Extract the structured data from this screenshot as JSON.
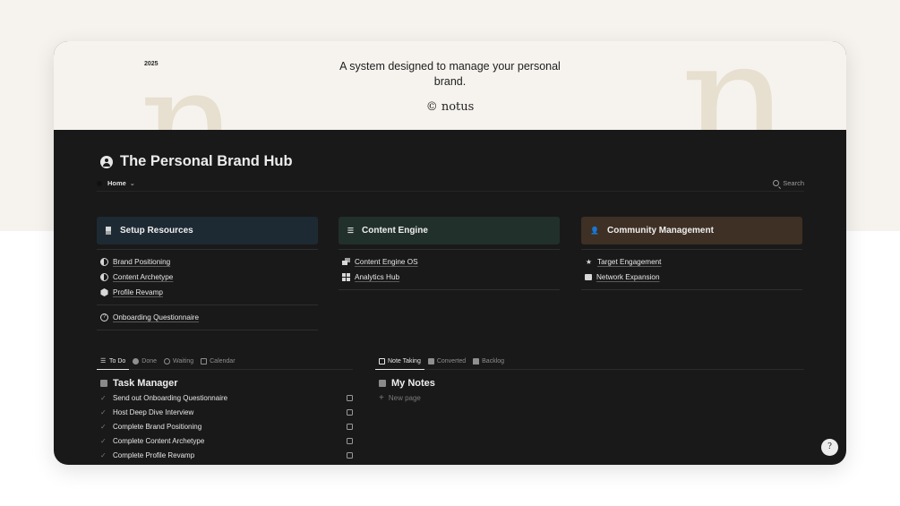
{
  "hero": {
    "year": "2025",
    "tagline": "A system designed to manage your personal brand.",
    "logo": "© notus",
    "decor_letter": "n"
  },
  "page": {
    "title": "The Personal Brand Hub",
    "nav": {
      "home_label": "Home",
      "search_label": "Search"
    }
  },
  "sections": [
    {
      "title": "Setup Resources",
      "icon": "stack-icon",
      "color": "#1e2a33",
      "links": [
        {
          "label": "Brand Positioning",
          "icon": "compass-icon"
        },
        {
          "label": "Content Archetype",
          "icon": "contrast-icon"
        },
        {
          "label": "Profile Revamp",
          "icon": "hexagon-icon"
        }
      ],
      "extra_links": [
        {
          "label": "Onboarding Questionnaire",
          "icon": "question-icon"
        }
      ]
    },
    {
      "title": "Content Engine",
      "icon": "list-icon",
      "color": "#21302a",
      "links": [
        {
          "label": "Content Engine OS",
          "icon": "layers-icon"
        },
        {
          "label": "Analytics Hub",
          "icon": "grid-icon"
        }
      ]
    },
    {
      "title": "Community Management",
      "icon": "user-check-icon",
      "color": "#3e3024",
      "links": [
        {
          "label": "Target Engagement",
          "icon": "star-icon"
        },
        {
          "label": "Network Expansion",
          "icon": "puzzle-icon"
        }
      ]
    }
  ],
  "tasks": {
    "tabs": [
      {
        "label": "To Do",
        "active": true
      },
      {
        "label": "Done",
        "active": false
      },
      {
        "label": "Waiting",
        "active": false
      },
      {
        "label": "Calendar",
        "active": false
      }
    ],
    "title": "Task Manager",
    "items": [
      "Send out Onboarding Questionnaire",
      "Host Deep Dive Interview",
      "Complete Brand Positioning",
      "Complete Content Archetype",
      "Complete Profile Revamp"
    ]
  },
  "notes": {
    "tabs": [
      {
        "label": "Note Taking",
        "active": true
      },
      {
        "label": "Converted",
        "active": false
      },
      {
        "label": "Backlog",
        "active": false
      }
    ],
    "title": "My Notes",
    "new_page": "New page"
  },
  "help_glyph": "?"
}
